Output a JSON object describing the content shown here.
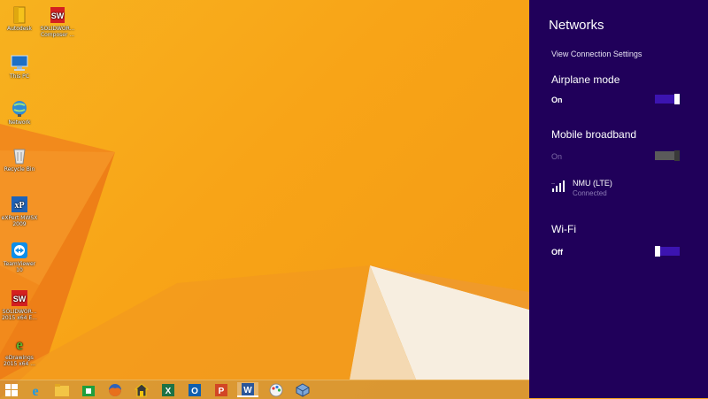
{
  "desktop": {
    "icons": [
      {
        "label": "Autodesk",
        "icon": "folder-icon"
      },
      {
        "label": "SOLIDWOR... Composer ...",
        "icon": "solidworks-composer-icon"
      },
      {
        "label": "This PC",
        "icon": "computer-icon"
      },
      {
        "label": "Network",
        "icon": "network-icon"
      },
      {
        "label": "Recycle Bin",
        "icon": "recycle-bin-icon"
      },
      {
        "label": "eXPert MWSX 2009",
        "icon": "expert-icon"
      },
      {
        "label": "TeamViewer 10",
        "icon": "teamviewer-icon"
      },
      {
        "label": "SOLIDWOR... 2015 x64 E...",
        "icon": "solidworks-icon"
      },
      {
        "label": "eDrawings 2015 x64 ...",
        "icon": "edrawings-icon"
      }
    ]
  },
  "taskbar": {
    "items": [
      {
        "name": "start-button",
        "icon": "windows-logo-icon"
      },
      {
        "name": "internet-explorer-button",
        "icon": "internet-explorer-icon"
      },
      {
        "name": "file-explorer-button",
        "icon": "folder-icon"
      },
      {
        "name": "store-button",
        "icon": "store-icon"
      },
      {
        "name": "firefox-button",
        "icon": "firefox-icon"
      },
      {
        "name": "secure-app-button",
        "icon": "shield-house-icon"
      },
      {
        "name": "excel-button",
        "icon": "excel-icon"
      },
      {
        "name": "outlook-button",
        "icon": "outlook-icon"
      },
      {
        "name": "powerpoint-button",
        "icon": "powerpoint-icon"
      },
      {
        "name": "word-button",
        "icon": "word-icon",
        "active": true
      },
      {
        "name": "paint-button",
        "icon": "paint-icon"
      },
      {
        "name": "virtualbox-button",
        "icon": "virtualbox-icon"
      }
    ]
  },
  "networks": {
    "title": "Networks",
    "view_settings": "View Connection Settings",
    "airplane": {
      "heading": "Airplane mode",
      "state": "On",
      "on": true
    },
    "mobile": {
      "heading": "Mobile broadband",
      "state": "On",
      "enabled": false,
      "connection": {
        "name": "NMU (LTE)",
        "status": "Connected",
        "icon": "signal-bars-icon"
      }
    },
    "wifi": {
      "heading": "Wi-Fi",
      "state": "Off",
      "on": false
    }
  },
  "colors": {
    "panel_bg": "#20005a",
    "toggle_on": "#3c14b0",
    "wallpaper": "#f8a417"
  }
}
